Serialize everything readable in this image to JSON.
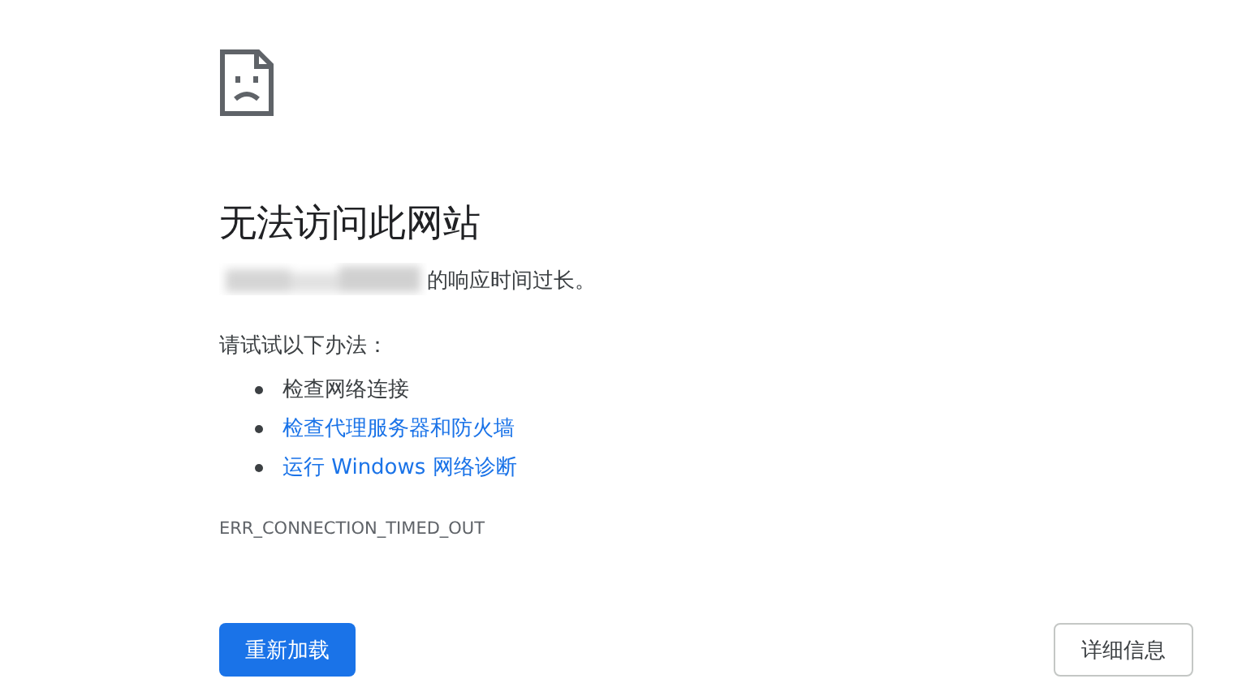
{
  "error": {
    "title": "无法访问此网站",
    "message": "的响应时间过长。",
    "suggestions_heading": "请试试以下办法：",
    "suggestions": [
      {
        "text": "检查网络连接",
        "kind": "text"
      },
      {
        "text": "检查代理服务器和防火墙",
        "kind": "link"
      },
      {
        "text": "运行 Windows 网络诊断",
        "kind": "link"
      }
    ],
    "code": "ERR_CONNECTION_TIMED_OUT"
  },
  "buttons": {
    "reload": "重新加载",
    "details": "详细信息"
  }
}
